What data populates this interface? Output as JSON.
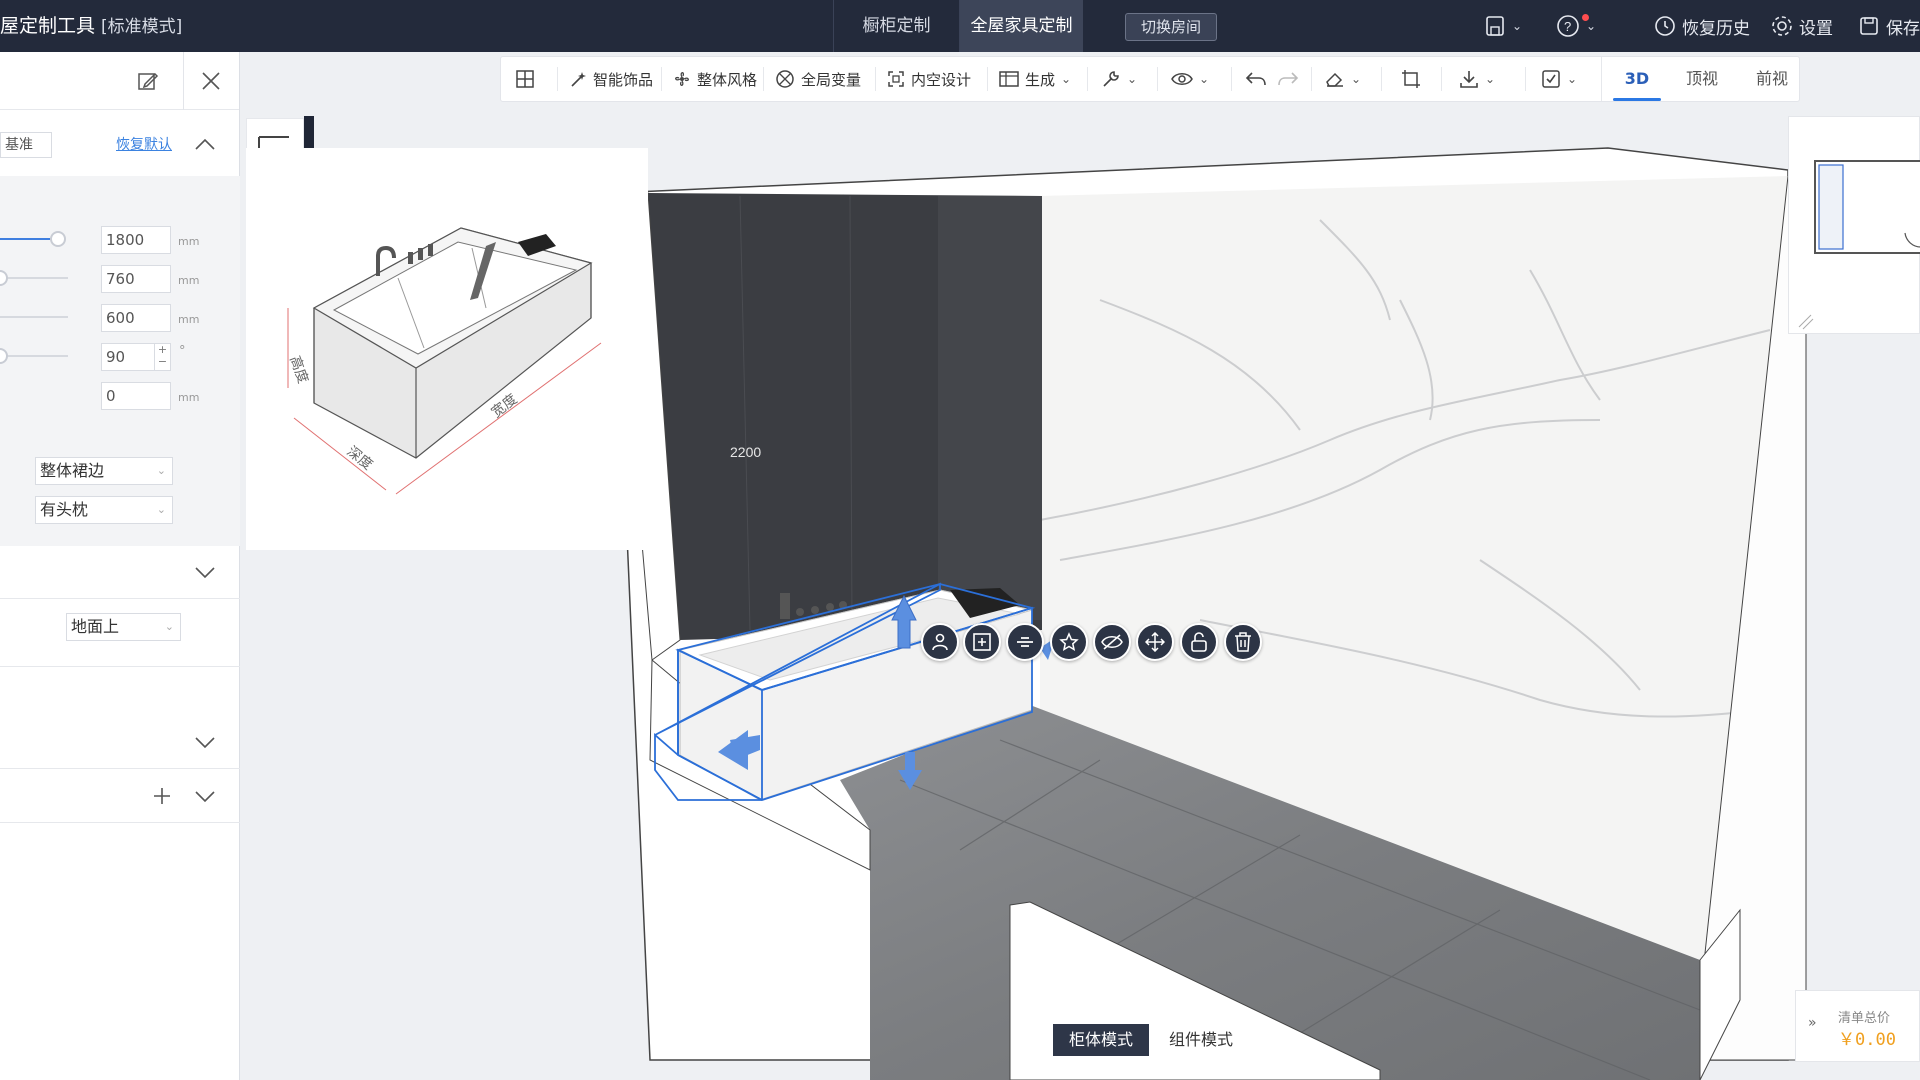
{
  "header": {
    "app_title": "屋定制工具",
    "mode_label": "[标准模式]",
    "tabs": [
      {
        "label": "橱柜定制"
      },
      {
        "label": "全屋家具定制"
      }
    ],
    "switch_room": "切换房间",
    "restore_history": "恢复历史",
    "settings": "设置",
    "save": "保存"
  },
  "left_panel": {
    "base_select": "基准",
    "restore_default": "恢复默认",
    "params": [
      {
        "value": "1800",
        "unit": "mm"
      },
      {
        "value": "760",
        "unit": "mm"
      },
      {
        "value": "600",
        "unit": "mm"
      },
      {
        "value": "90",
        "unit": "°"
      },
      {
        "value": "0",
        "unit": "mm"
      }
    ],
    "skirt_select": "整体裙边",
    "pillow_select": "有头枕",
    "position_select": "地面上"
  },
  "toolbar": {
    "smart_decor": "智能饰品",
    "overall_style": "整体风格",
    "global_replace": "全局变量",
    "cavity_design": "内空设计",
    "generate": "生成",
    "views": [
      "3D",
      "顶视",
      "前视"
    ]
  },
  "preview": {
    "label_height": "高度",
    "label_depth": "深度",
    "label_width": "宽度"
  },
  "scene": {
    "dimension_label": "2200",
    "selection_color": "#2b6fd8"
  },
  "bottom": {
    "modes": [
      "柜体模式",
      "组件模式"
    ]
  },
  "price": {
    "label": "清单总价",
    "value": "￥0.00"
  }
}
